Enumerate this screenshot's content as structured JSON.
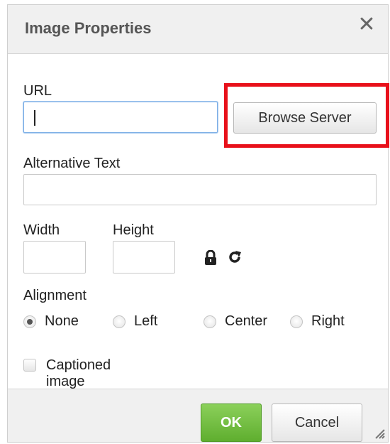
{
  "dialog": {
    "title": "Image Properties",
    "close_icon": "close-icon"
  },
  "form": {
    "url_label": "URL",
    "url_value": "",
    "browse_label": "Browse Server",
    "alt_label": "Alternative Text",
    "alt_value": "",
    "width_label": "Width",
    "width_value": "",
    "height_label": "Height",
    "height_value": "",
    "lock_icon": "lock-icon",
    "reset_icon": "reset-size-icon",
    "alignment_label": "Alignment",
    "alignment_options": [
      "None",
      "Left",
      "Center",
      "Right"
    ],
    "alignment_selected": "None",
    "captioned_label": "Captioned image",
    "captioned_checked": false
  },
  "footer": {
    "ok_label": "OK",
    "cancel_label": "Cancel",
    "resize_icon": "resize-grip-icon"
  },
  "colors": {
    "highlight": "#e8101a",
    "ok_button": "#6dbb3c",
    "focus_border": "#7fb0e6"
  }
}
